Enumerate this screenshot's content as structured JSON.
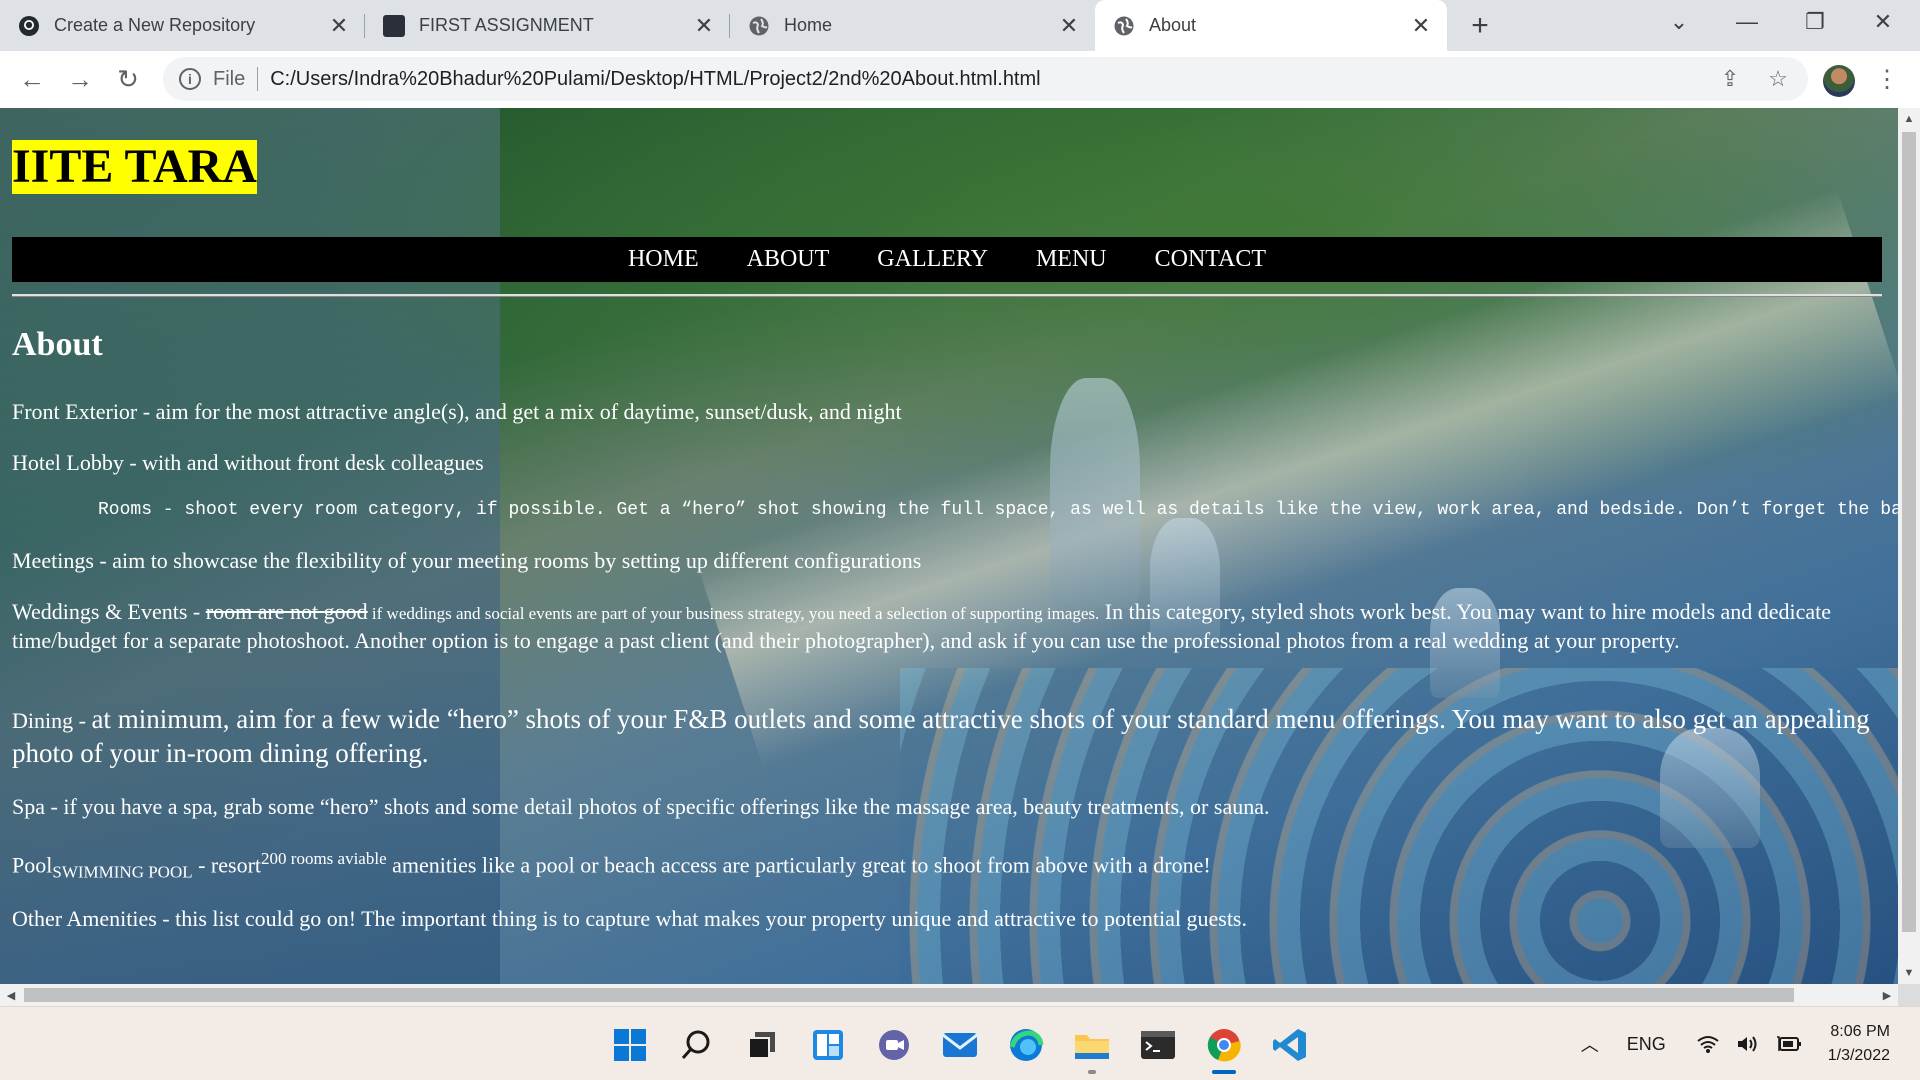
{
  "browser": {
    "tabs": [
      {
        "label": "Create a New Repository",
        "icon": "github-icon"
      },
      {
        "label": "FIRST ASSIGNMENT",
        "icon": "image-favicon"
      },
      {
        "label": "Home",
        "icon": "globe-icon"
      },
      {
        "label": "About",
        "icon": "globe-icon",
        "active": true
      }
    ],
    "address": {
      "scheme": "File",
      "url": "C:/Users/Indra%20Bhadur%20Pulami/Desktop/HTML/Project2/2nd%20About.html.html"
    }
  },
  "page": {
    "site_title": "IITE TARA",
    "nav": [
      "HOME",
      "ABOUT",
      "GALLERY",
      "MENU",
      "CONTACT"
    ],
    "heading": "About",
    "front_exterior": "Front Exterior - aim for the most attractive angle(s), and get a mix of daytime, sunset/dusk, and night",
    "hotel_lobby": "Hotel Lobby - with and without front desk colleagues",
    "rooms_pre": "Rooms - shoot every room category, if possible. Get a “hero” shot showing the full space, as well as details like the view, work area, and bedside. Don’t forget the bat",
    "meetings": "Meetings - aim to showcase the flexibility of your meeting rooms by setting up different configurations",
    "weddings": {
      "lead": "Weddings & Events - ",
      "struck": "room are not good",
      "small": " if weddings and social events are part of your business strategy, you need a selection of supporting images.",
      "rest": " In this category, styled shots work best. You may want to hire models and dedicate time/budget for a separate photoshoot. Another option is to engage a past client (and their photographer), and ask if you can use the professional photos from a real wedding at your property."
    },
    "dining": {
      "lead": "Dining - ",
      "big": "at minimum, aim for a few wide “hero” shots of your F&B outlets and some attractive shots of your standard menu offerings. You may want to also get an appealing photo of your in-room dining offering."
    },
    "spa": "Spa - if you have a spa, grab some “hero” shots and some detail photos of specific offerings like the massage area, beauty treatments, or sauna.",
    "pool": {
      "lead": "Pool",
      "sub": "SWIMMING POOL",
      "mid": " - resort",
      "sup": "200 rooms aviable",
      "rest": " amenities like a pool or beach access are particularly great to shoot from above with a drone!"
    },
    "other": "Other Amenities - this list could go on! The important thing is to capture what makes your property unique and attractive to potential guests."
  },
  "taskbar": {
    "apps": [
      "start-icon",
      "search-icon",
      "task-view-icon",
      "widgets-icon",
      "chat-icon",
      "mail-icon",
      "edge-icon",
      "file-explorer-icon",
      "terminal-icon",
      "chrome-icon",
      "vscode-icon"
    ],
    "tray": {
      "language": "ENG",
      "time": "8:06 PM",
      "date": "1/3/2022"
    }
  },
  "colors": {
    "title_bg": "#ffff00",
    "nav_bg": "#000000",
    "tab_strip": "#dee1e6"
  }
}
